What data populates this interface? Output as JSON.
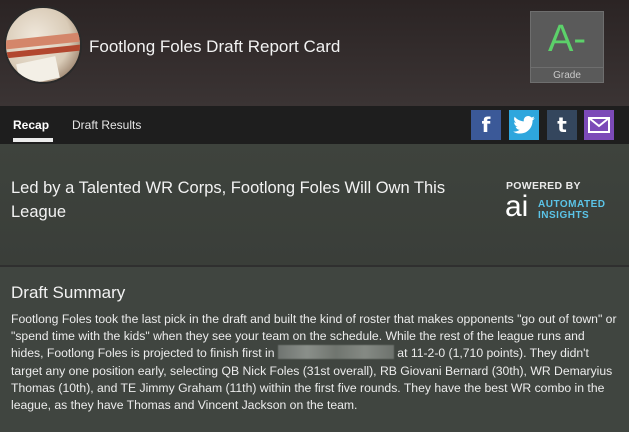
{
  "header": {
    "title": "Footlong Foles Draft Report Card",
    "grade": "A-",
    "grade_label": "Grade",
    "grade_color": "#5cd16a"
  },
  "nav": {
    "tabs": [
      {
        "label": "Recap",
        "active": true
      },
      {
        "label": "Draft Results",
        "active": false
      }
    ],
    "share_icons": [
      "facebook-icon",
      "twitter-icon",
      "tumblr-icon",
      "email-icon"
    ]
  },
  "headline": {
    "text": "Led by a Talented WR Corps, Footlong Foles Will Own This League",
    "powered_by": "POWERED BY",
    "brand_mark": "ai",
    "brand_line1": "AUTOMATED",
    "brand_line2": "INSIGHTS"
  },
  "summary": {
    "heading": "Draft Summary",
    "body_before": "Footlong Foles took the last pick in the draft and built the kind of roster that makes opponents \"go out of town\" or \"spend time with the kids\" when they see your team on the schedule. While the rest of the league runs and hides, Footlong Foles is projected to finish first in",
    "body_after": "at 11-2-0 (1,710 points). They didn't target any one position early, selecting QB Nick Foles (31st overall), RB Giovani Bernard (30th), WR Demaryius Thomas (10th), and TE Jimmy Graham (11th) within the first five rounds. They have the best WR combo in the league, as they have Thomas and Vincent Jackson on the team."
  }
}
